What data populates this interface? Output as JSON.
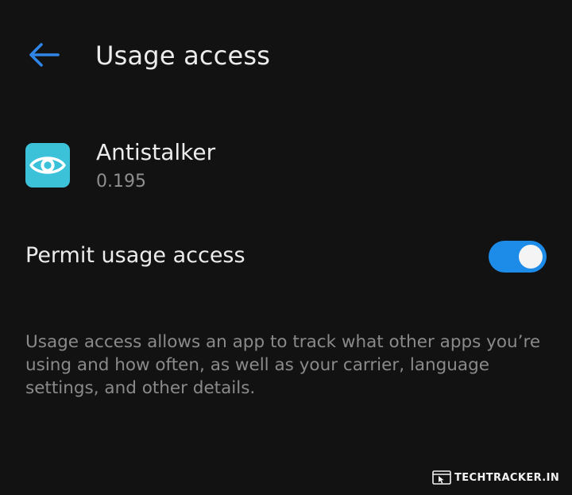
{
  "header": {
    "back_icon": "arrow-left-icon",
    "title": "Usage access"
  },
  "app": {
    "icon": "eye-icon",
    "name": "Antistalker",
    "version": "0.195"
  },
  "permission": {
    "label": "Permit usage access",
    "enabled": true
  },
  "description": "Usage access allows an app to track what other apps you’re using and how often, as well as your carrier, language settings, and other details.",
  "watermark": {
    "icon": "browser-cursor-icon",
    "text": "TECHTRACKER.IN"
  },
  "colors": {
    "background": "#121212",
    "accent": "#1d8be8",
    "app_icon_bg": "#3bc2d9",
    "primary_text": "#ececec",
    "secondary_text": "#8a8a8a"
  }
}
